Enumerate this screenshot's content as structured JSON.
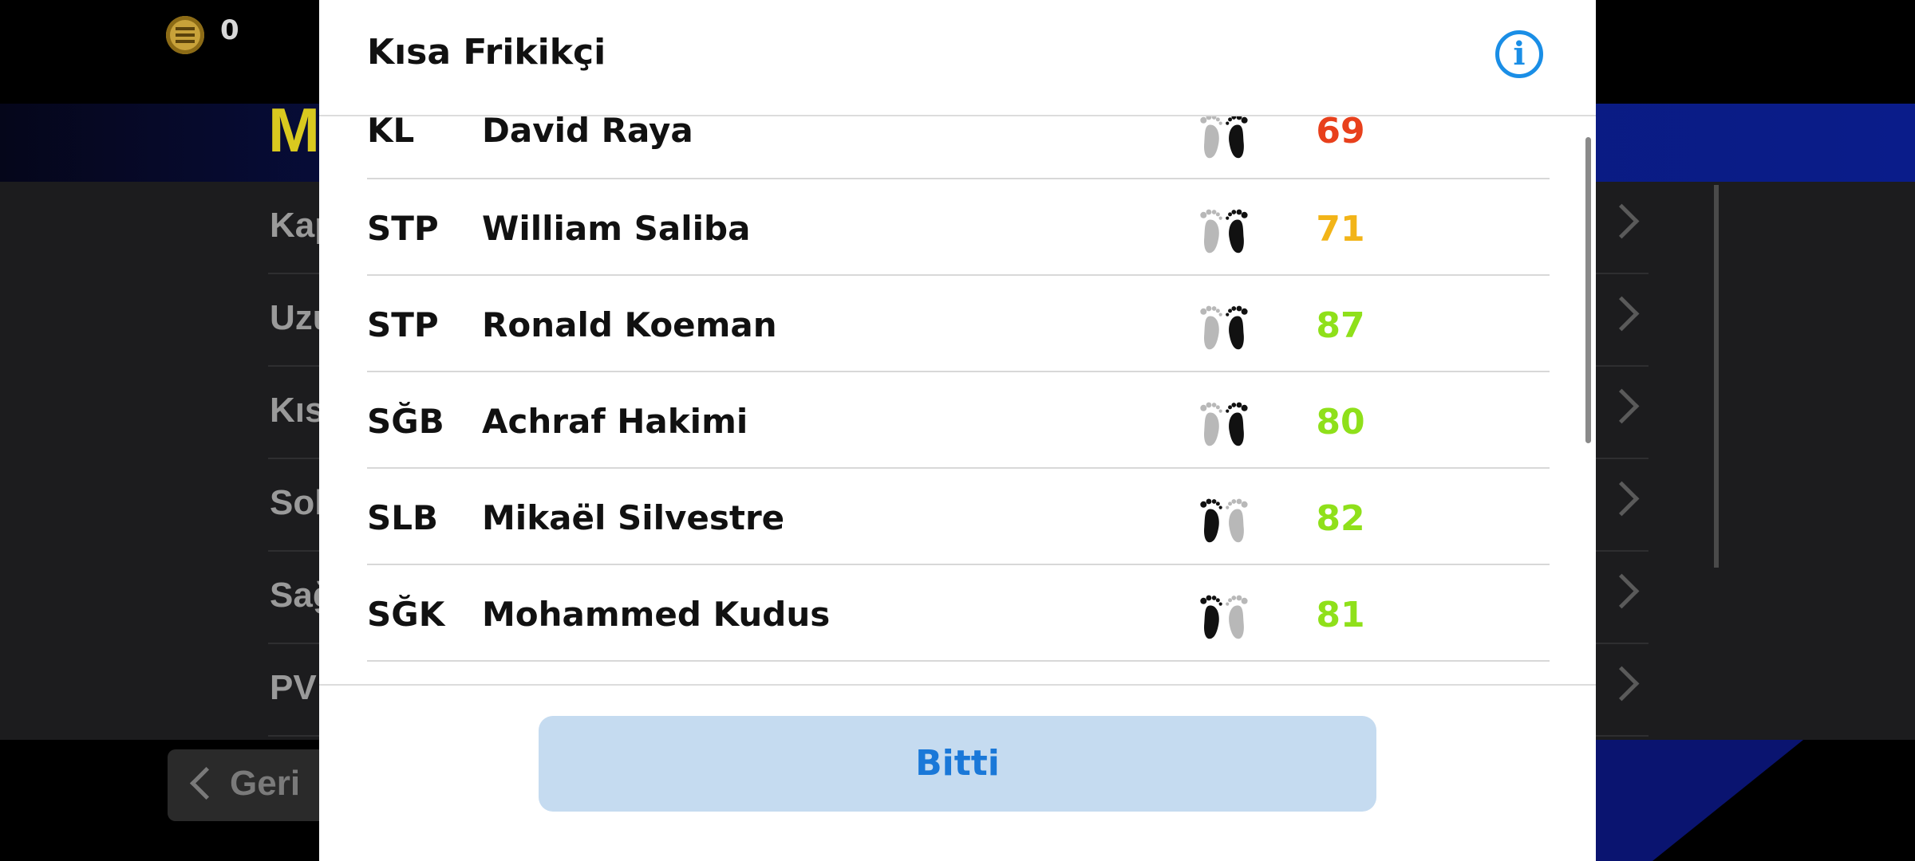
{
  "background": {
    "coins": "0",
    "title": "M",
    "menu_items": [
      "Kap",
      "Uzu",
      "Kıs",
      "Sol",
      "Sağ",
      "PV"
    ],
    "back_label": "Geri"
  },
  "modal": {
    "title": "Kısa Frikikçi",
    "info_label": "i",
    "done_label": "Bitti",
    "players": [
      {
        "position": "KL",
        "name": "David Raya",
        "foot": "right",
        "rating": "69",
        "color": "#e8401c"
      },
      {
        "position": "STP",
        "name": "William Saliba",
        "foot": "right",
        "rating": "71",
        "color": "#f2b418"
      },
      {
        "position": "STP",
        "name": "Ronald Koeman",
        "foot": "right",
        "rating": "87",
        "color": "#8fe01a"
      },
      {
        "position": "SĞB",
        "name": "Achraf Hakimi",
        "foot": "right",
        "rating": "80",
        "color": "#8fe01a"
      },
      {
        "position": "SLB",
        "name": "Mikaël Silvestre",
        "foot": "left",
        "rating": "82",
        "color": "#8fe01a"
      },
      {
        "position": "SĞK",
        "name": "Mohammed Kudus",
        "foot": "left",
        "rating": "81",
        "color": "#8fe01a"
      }
    ]
  }
}
